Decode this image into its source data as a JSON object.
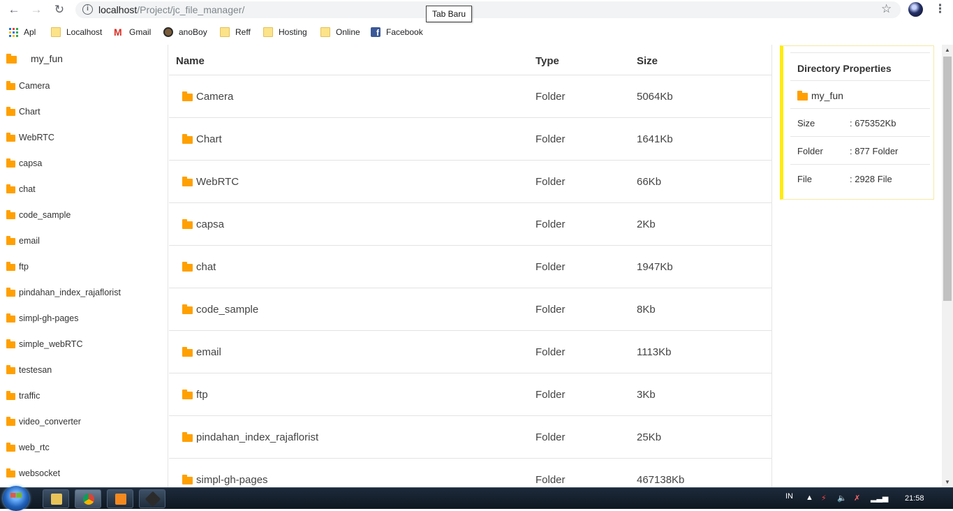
{
  "browser": {
    "url_host": "localhost",
    "url_path": "/Project/jc_file_manager/",
    "tooltip": "Tab Baru"
  },
  "bookmarks": [
    {
      "label": "Apl",
      "icon": "apps-grid-icon"
    },
    {
      "label": "Localhost",
      "icon": "folder-icon"
    },
    {
      "label": "Gmail",
      "icon": "gmail-icon"
    },
    {
      "label": "anoBoy",
      "icon": "anoboy-icon"
    },
    {
      "label": "Reff",
      "icon": "folder-icon"
    },
    {
      "label": "Hosting",
      "icon": "folder-icon"
    },
    {
      "label": "Online",
      "icon": "folder-icon"
    },
    {
      "label": "Facebook",
      "icon": "facebook-icon"
    }
  ],
  "sidebar": {
    "root": "my_fun",
    "items": [
      "Camera",
      "Chart",
      "WebRTC",
      "capsa",
      "chat",
      "code_sample",
      "email",
      "ftp",
      "pindahan_index_rajaflorist",
      "simpl-gh-pages",
      "simple_webRTC",
      "testesan",
      "traffic",
      "video_converter",
      "web_rtc",
      "websocket"
    ]
  },
  "table": {
    "headers": {
      "name": "Name",
      "type": "Type",
      "size": "Size"
    },
    "rows": [
      {
        "name": "Camera",
        "type": "Folder",
        "size": "5064Kb"
      },
      {
        "name": "Chart",
        "type": "Folder",
        "size": "1641Kb"
      },
      {
        "name": "WebRTC",
        "type": "Folder",
        "size": "66Kb"
      },
      {
        "name": "capsa",
        "type": "Folder",
        "size": "2Kb"
      },
      {
        "name": "chat",
        "type": "Folder",
        "size": "1947Kb"
      },
      {
        "name": "code_sample",
        "type": "Folder",
        "size": "8Kb"
      },
      {
        "name": "email",
        "type": "Folder",
        "size": "1113Kb"
      },
      {
        "name": "ftp",
        "type": "Folder",
        "size": "3Kb"
      },
      {
        "name": "pindahan_index_rajaflorist",
        "type": "Folder",
        "size": "25Kb"
      },
      {
        "name": "simpl-gh-pages",
        "type": "Folder",
        "size": "467138Kb"
      }
    ]
  },
  "properties": {
    "title": "Directory Properties",
    "name": "my_fun",
    "rows": [
      {
        "label": "Size",
        "value": ": 675352Kb"
      },
      {
        "label": "Folder",
        "value": ": 877 Folder"
      },
      {
        "label": "File",
        "value": ": 2928 File"
      }
    ]
  },
  "taskbar": {
    "lang": "IN",
    "time": "21:58"
  },
  "colors": {
    "folder": "#ffa000",
    "props_accent": "#ffeb10"
  }
}
